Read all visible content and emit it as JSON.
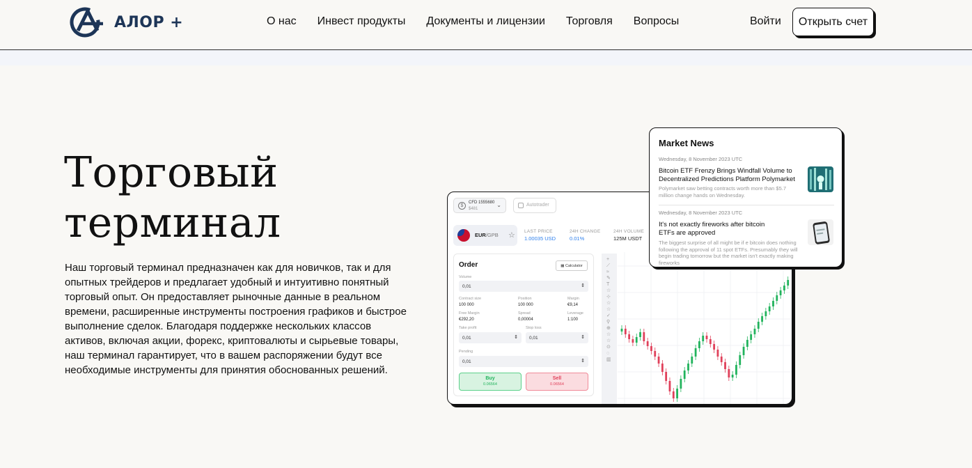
{
  "header": {
    "logo_text": "АЛОР +",
    "nav": [
      "О нас",
      "Инвест продукты",
      "Документы и лицензии",
      "Торговля",
      "Вопросы"
    ],
    "login_label": "Войти",
    "open_account_label": "Открыть счет"
  },
  "hero": {
    "title_line1": "Торговый",
    "title_line2": "терминал",
    "description": "Наш торговый терминал предназначен как для новичков, так и для опытных трейдеров и предлагает удобный и интуитивно понятный торговый опыт. Он предоставляет рыночные данные в реальном времени, расширенные инструменты построения графиков и быстрое выполнение сделок. Благодаря поддержке нескольких классов активов, включая акции, форекс, криптовалюты и сырьевые товары, наш терминал гарантирует, что в вашем распоряжении будут все необходимые инструменты для принятия обоснованных решений."
  },
  "terminal": {
    "account_id": "CFD 1555680",
    "account_balance": "$481",
    "autotrader_label": "Autotrader",
    "pair_base": "EUR",
    "pair_quote": "/GPB",
    "stats": [
      {
        "label": "LAST PRICE",
        "value": "1.00035 USD"
      },
      {
        "label": "24H CHANGE",
        "value": "0.01%"
      },
      {
        "label": "24H VOLUME",
        "value": "125M USDT"
      }
    ],
    "colors": {
      "accent_blue": "#2f80ed",
      "buy_green": "#21b35c",
      "sell_red": "#e0405a"
    },
    "order": {
      "title": "Order",
      "calculator_label": "Calculator",
      "volume_label": "Volume",
      "volume_value": "0,01",
      "details": [
        {
          "label": "Contract size",
          "value": "100 000"
        },
        {
          "label": "Position",
          "value": "100 000"
        },
        {
          "label": "Margin",
          "value": "€9,14"
        },
        {
          "label": "Free Margin",
          "value": "€292,20"
        },
        {
          "label": "Spread",
          "value": "0,00004"
        },
        {
          "label": "Leverage",
          "value": "1:100"
        }
      ],
      "take_profit_label": "Take profit",
      "take_profit_value": "0,01",
      "stop_loss_label": "Stop loss",
      "stop_loss_value": "0,01",
      "pending_label": "Pending",
      "pending_value": "0,01",
      "buy_label": "Buy",
      "buy_price": "0.06564",
      "sell_label": "Sell",
      "sell_price": "0.06564"
    }
  },
  "news": {
    "title": "Market News",
    "items": [
      {
        "date": "Wednesday, 8 November 2023 UTC",
        "title": "Bitcoin ETF Frenzy Brings Windfall Volume to Decentralized Predictions Platform Polymarket",
        "summary": "Polymarket saw betting contracts worth more than $5.7 million change hands on Wednesday."
      },
      {
        "date": "Wednesday, 8 November 2023 UTC",
        "title": "It's not exactly fireworks after bitcoin ETFs are approved",
        "summary": "The biggest surprise of all might be if e bitcoin does nothing following the approval of 11 spot ETFs. Presumably they will begin trading tomorrow but the market isn't exactly making fireworks"
      }
    ]
  }
}
